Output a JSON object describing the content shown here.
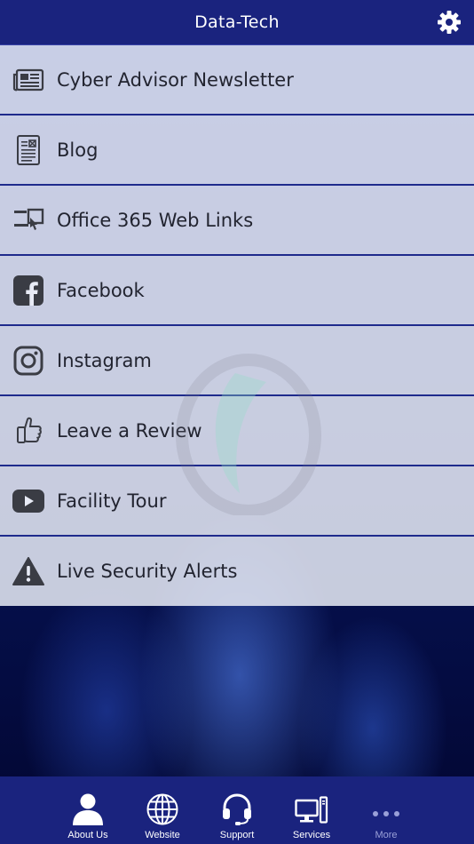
{
  "header": {
    "title": "Data-Tech"
  },
  "menu": {
    "items": [
      {
        "label": "Cyber Advisor Newsletter",
        "icon": "newspaper-icon"
      },
      {
        "label": "Blog",
        "icon": "document-icon"
      },
      {
        "label": "Office 365 Web Links",
        "icon": "web-links-icon"
      },
      {
        "label": "Facebook",
        "icon": "facebook-icon"
      },
      {
        "label": "Instagram",
        "icon": "instagram-icon"
      },
      {
        "label": "Leave a Review",
        "icon": "thumbs-up-icon"
      },
      {
        "label": "Facility Tour",
        "icon": "youtube-icon"
      },
      {
        "label": "Live Security Alerts",
        "icon": "warning-icon"
      }
    ]
  },
  "tabbar": {
    "tabs": [
      {
        "label": "About Us",
        "icon": "person-icon"
      },
      {
        "label": "Website",
        "icon": "globe-icon"
      },
      {
        "label": "Support",
        "icon": "headset-icon"
      },
      {
        "label": "Services",
        "icon": "computer-icon"
      },
      {
        "label": "More",
        "icon": "more-dots-icon"
      }
    ]
  },
  "colors": {
    "header_bg": "#1a237e",
    "accent": "#1e2a8c",
    "menu_bg": "#e8ebf6"
  }
}
